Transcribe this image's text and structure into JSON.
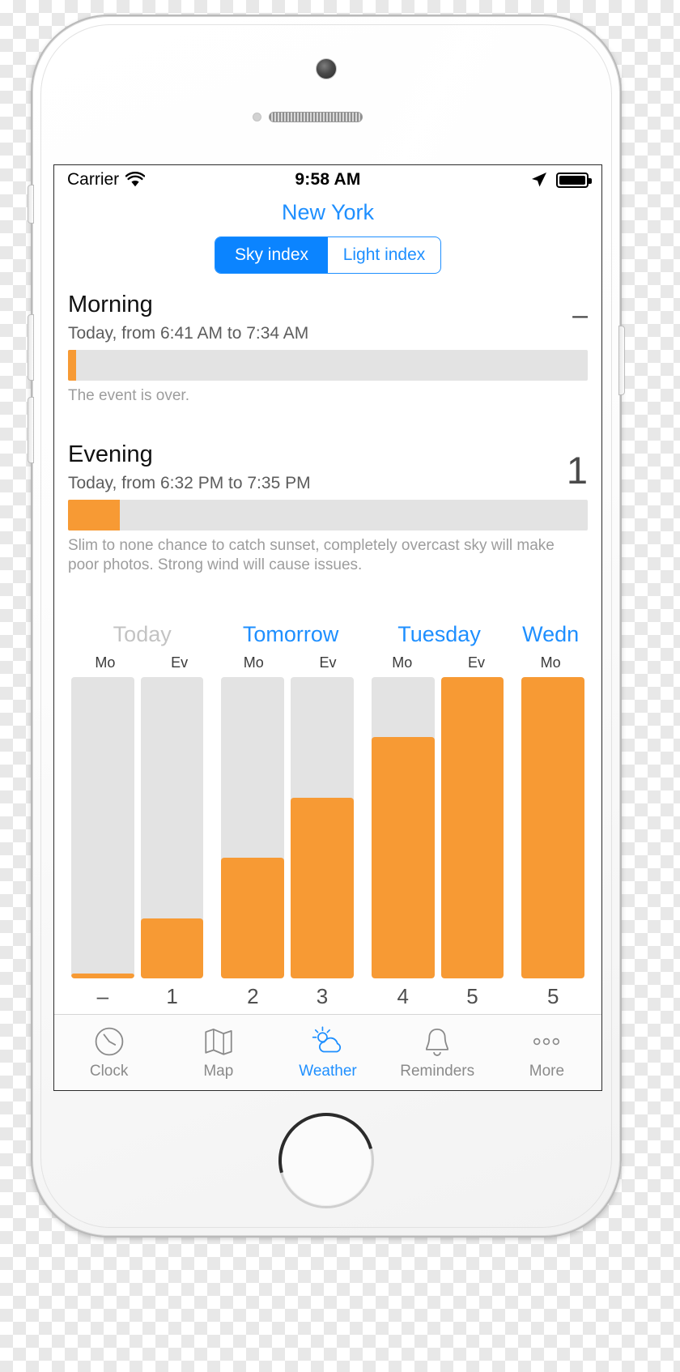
{
  "status_bar": {
    "carrier": "Carrier",
    "wifi_icon": "wifi-icon",
    "time": "9:58 AM",
    "location_icon": "location-arrow-icon",
    "battery_icon": "battery-full-icon"
  },
  "header": {
    "city": "New York"
  },
  "segmented_control": {
    "options": [
      {
        "label": "Sky index",
        "selected": true
      },
      {
        "label": "Light index",
        "selected": false
      }
    ]
  },
  "events": [
    {
      "name": "morning",
      "title": "Morning",
      "subtitle": "Today, from 6:41 AM to  7:34 AM",
      "score": "–",
      "progress_percent": 1.5,
      "note": "The event is over."
    },
    {
      "name": "evening",
      "title": "Evening",
      "subtitle": "Today, from 6:32 PM to  7:35 PM",
      "score": "1",
      "progress_percent": 10,
      "note": "Slim to none chance to catch sunset, completely overcast sky will make poor photos. Strong wind will cause issues."
    }
  ],
  "colors": {
    "accent_blue": "#1e8fff",
    "segment_blue": "#0b84ff",
    "bar_orange": "#f79a34",
    "bar_track_gray": "#e3e3e3",
    "muted_gray": "#9d9d9d"
  },
  "chart_data": {
    "type": "bar",
    "title": "",
    "xlabel": "",
    "ylabel": "",
    "ylim": [
      0,
      5
    ],
    "grid": false,
    "legend": "none",
    "days": [
      {
        "label": "Today",
        "past": true,
        "span": 2
      },
      {
        "label": "Tomorrow",
        "past": false,
        "span": 2
      },
      {
        "label": "Tuesday",
        "past": false,
        "span": 2
      },
      {
        "label": "Wedn",
        "past": false,
        "span": 1
      }
    ],
    "categories": [
      "Mo",
      "Ev",
      "Mo",
      "Ev",
      "Mo",
      "Ev",
      "Mo"
    ],
    "value_labels": [
      "–",
      "1",
      "2",
      "3",
      "4",
      "5",
      "5"
    ],
    "values": [
      0.08,
      1,
      2,
      3,
      4,
      5,
      5
    ],
    "track_max": 5
  },
  "tab_bar": {
    "tabs": [
      {
        "label": "Clock",
        "icon": "clock-icon",
        "active": false
      },
      {
        "label": "Map",
        "icon": "map-icon",
        "active": false
      },
      {
        "label": "Weather",
        "icon": "sun-cloud-icon",
        "active": true
      },
      {
        "label": "Reminders",
        "icon": "bell-icon",
        "active": false
      },
      {
        "label": "More",
        "icon": "ellipsis-icon",
        "active": false
      }
    ]
  }
}
